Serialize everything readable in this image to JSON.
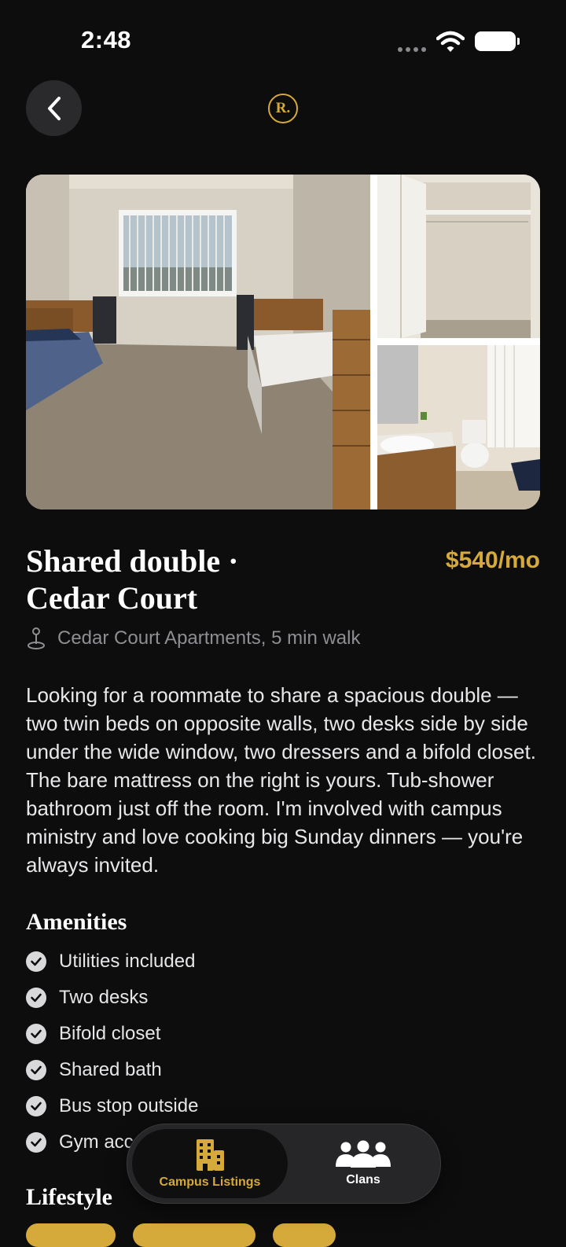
{
  "status": {
    "time": "2:48"
  },
  "header": {
    "logo_text": "R."
  },
  "listing": {
    "title_line1": "Shared double ·",
    "title_line2": "Cedar Court",
    "price": "$540/mo",
    "location": "Cedar Court Apartments, 5 min walk",
    "description": "Looking for a roommate to share a spacious double — two twin beds on opposite walls, two desks side by side under the wide window, two dressers and a bifold closet. The bare mattress on the right is yours. Tub-shower bathroom just off the room. I'm involved with campus ministry and love cooking big Sunday dinners — you're always invited."
  },
  "amenities": {
    "heading": "Amenities",
    "items": [
      "Utilities included",
      "Two desks",
      "Bifold closet",
      "Shared bath",
      "Bus stop outside",
      "Gym acc"
    ]
  },
  "lifestyle": {
    "heading": "Lifestyle"
  },
  "tabbar": {
    "tabs": [
      {
        "label": "Campus Listings"
      },
      {
        "label": "Clans"
      }
    ]
  },
  "colors": {
    "accent": "#d6aa3a",
    "background": "#0d0d0e"
  }
}
